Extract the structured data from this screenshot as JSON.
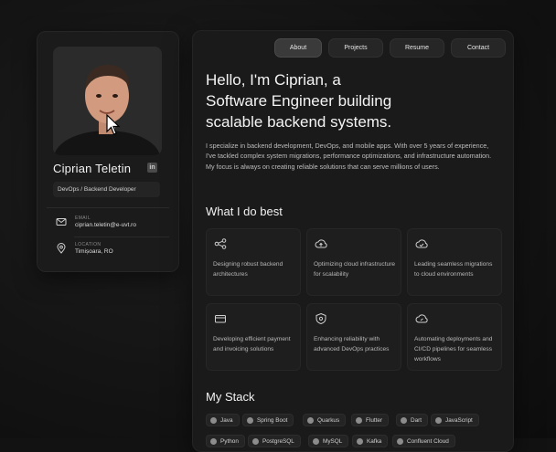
{
  "profile": {
    "name": "Ciprian Teletin",
    "linkedin_glyph": "in",
    "role": "DevOps / Backend Developer",
    "email_label": "EMAIL",
    "email": "ciprian.teletin@e-uvt.ro",
    "location_label": "LOCATION",
    "location": "Timișoara, RO"
  },
  "nav": {
    "about": "About",
    "projects": "Projects",
    "resume": "Resume",
    "contact": "Contact"
  },
  "hero": {
    "line1": "Hello, I'm Ciprian, a",
    "line2": "Software Engineer building",
    "line3": "scalable backend systems.",
    "intro": "I specialize in backend development, DevOps, and mobile apps. With over 5 years of experience, I've tackled complex system migrations, performance optimizations, and infrastructure automation. My focus is always on creating reliable solutions that can serve millions of users."
  },
  "services": {
    "title": "What I do best",
    "items": [
      {
        "icon": "nodes-icon",
        "text": "Designing robust backend architectures"
      },
      {
        "icon": "cloud-icon",
        "text": "Optimizing cloud infrastructure for scalability"
      },
      {
        "icon": "cloud-check-icon",
        "text": "Leading seamless migrations to cloud environments"
      },
      {
        "icon": "payment-card-icon",
        "text": "Developing efficient payment and invoicing solutions"
      },
      {
        "icon": "shield-gear-icon",
        "text": "Enhancing reliability with advanced DevOps practices"
      },
      {
        "icon": "cloud-deploy-icon",
        "text": "Automating deployments and CI/CD pipelines for seamless workflows"
      }
    ]
  },
  "stack": {
    "title": "My Stack",
    "row1": [
      "Java",
      "Spring Boot",
      "Quarkus",
      "Flutter",
      "Dart",
      "JavaScript"
    ],
    "row2": [
      "Python",
      "PostgreSQL",
      "MySQL",
      "Kafka",
      "Confluent Cloud"
    ]
  },
  "colors": {
    "background": "#121212",
    "card": "#1b1b1b",
    "text": "#f4f4f4",
    "muted": "#bdbdbd"
  }
}
